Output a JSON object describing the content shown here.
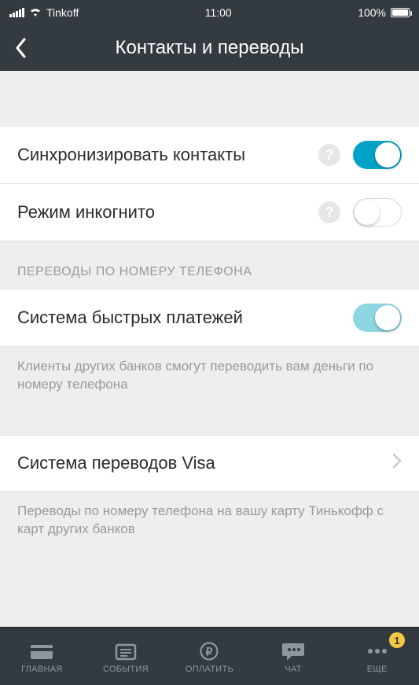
{
  "status": {
    "carrier": "Tinkoff",
    "time": "11:00",
    "battery_pct": "100%"
  },
  "header": {
    "title": "Контакты и переводы"
  },
  "rows": {
    "sync_contacts": {
      "label": "Синхронизировать контакты",
      "help": "?",
      "on": true
    },
    "incognito": {
      "label": "Режим инкогнито",
      "help": "?",
      "on": false
    },
    "sbp": {
      "label": "Система быстрых платежей",
      "on": true
    },
    "visa": {
      "label": "Система переводов Visa"
    }
  },
  "sections": {
    "transfers_header": "ПЕРЕВОДЫ ПО НОМЕРУ ТЕЛЕФОНА",
    "sbp_footer": "Клиенты других банков смогут переводить вам деньги по номеру телефона",
    "visa_footer": "Переводы по номеру телефона на вашу карту Тинькофф с карт других банков"
  },
  "tabs": {
    "home": "ГЛАВНАЯ",
    "events": "СОБЫТИЯ",
    "pay": "ОПЛАТИТЬ",
    "chat": "ЧАТ",
    "more": "ЕЩЕ",
    "more_badge": "1"
  }
}
